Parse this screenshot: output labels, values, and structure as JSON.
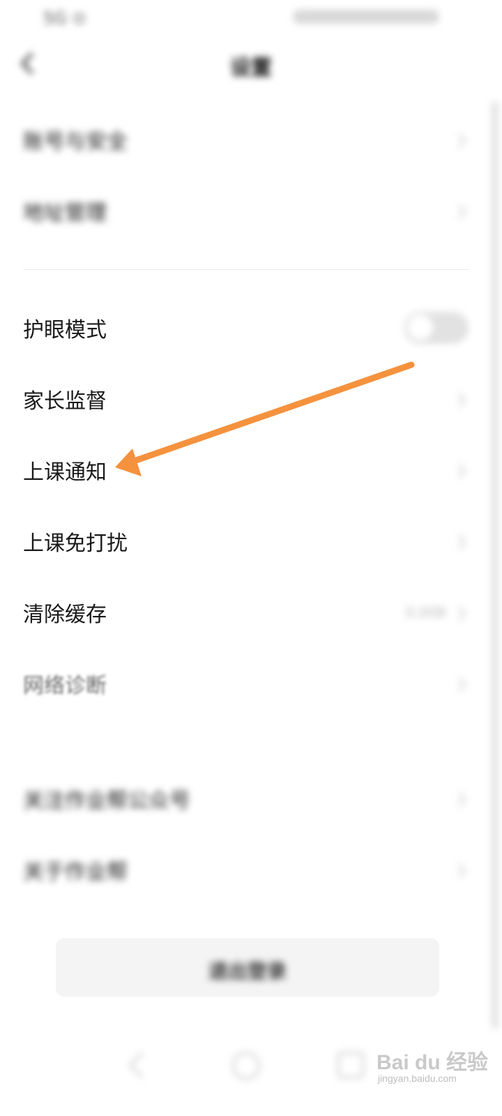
{
  "status_bar": {
    "left_text": "5G ⊙"
  },
  "nav": {
    "title": "设置"
  },
  "top_rows": [
    {
      "label": "账号与安全"
    },
    {
      "label": "地址管理"
    }
  ],
  "rows": [
    {
      "label": "护眼模式",
      "control": "toggle",
      "toggle_on": false
    },
    {
      "label": "家长监督"
    },
    {
      "label": "上课通知"
    },
    {
      "label": "上课免打扰"
    },
    {
      "label": "清除缓存",
      "value": "0.00B"
    },
    {
      "label": "网络诊断"
    }
  ],
  "bottom_rows": [
    {
      "label": "关注作业帮公众号"
    },
    {
      "label": "关于作业帮"
    }
  ],
  "logout_label": "退出登录",
  "watermark": {
    "logo": "Bai du 经验",
    "sub": "jingyan.baidu.com"
  },
  "annotation": {
    "color": "#F5923E",
    "points_to": "上课通知"
  }
}
